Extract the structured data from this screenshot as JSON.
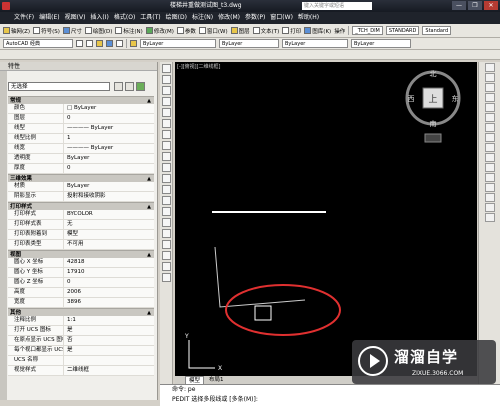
{
  "window": {
    "title": "楼梯井重做测试图_t3.dwg",
    "search_placeholder": "键入关键字或短语",
    "buttons": [
      "—",
      "❐",
      "✕"
    ]
  },
  "menubar": {
    "items": [
      "文件(F)",
      "编辑(E)",
      "视图(V)",
      "插入(I)",
      "格式(O)",
      "工具(T)",
      "绘图(D)",
      "标注(N)",
      "修改(M)",
      "参数(P)",
      "窗口(W)",
      "帮助(H)"
    ]
  },
  "toolbar1": {
    "items": [
      "轴网(Z)",
      "符号(S)",
      "尺寸",
      "绘图(D)",
      "标注(N)",
      "修改(M)",
      "参数",
      "窗口(W)",
      "图层",
      "文本(T)",
      "打印",
      "图库(K)",
      "操作"
    ],
    "dim_style": "_TCH_DIM",
    "text_style": "STANDARD",
    "standard": "Standard"
  },
  "toolbar2": {
    "workspace": "AutoCAD 经典",
    "layer_dropdown": "ByLayer",
    "color_dropdown": "ByLayer",
    "linetype_dropdown": "ByLayer",
    "plotstyle_dropdown": "ByLayer"
  },
  "properties": {
    "title": "特性",
    "selection": "无选择",
    "sections": [
      {
        "name": "常规",
        "rows": [
          {
            "k": "颜色",
            "v": "□ ByLayer"
          },
          {
            "k": "图层",
            "v": "0"
          },
          {
            "k": "线型",
            "v": "———— ByLayer"
          },
          {
            "k": "线型比例",
            "v": "1"
          },
          {
            "k": "线宽",
            "v": "———— ByLayer"
          },
          {
            "k": "透明度",
            "v": "ByLayer"
          },
          {
            "k": "厚度",
            "v": "0"
          }
        ]
      },
      {
        "name": "三维效果",
        "rows": [
          {
            "k": "材质",
            "v": "ByLayer"
          },
          {
            "k": "阴影显示",
            "v": "投射和接收阴影"
          }
        ]
      },
      {
        "name": "打印样式",
        "rows": [
          {
            "k": "打印样式",
            "v": "BYCOLOR"
          },
          {
            "k": "打印样式表",
            "v": "无"
          },
          {
            "k": "打印表附着到",
            "v": "模型"
          },
          {
            "k": "打印表类型",
            "v": "不可用"
          }
        ]
      },
      {
        "name": "视图",
        "rows": [
          {
            "k": "圆心 X 坐标",
            "v": "42818"
          },
          {
            "k": "圆心 Y 坐标",
            "v": "17910"
          },
          {
            "k": "圆心 Z 坐标",
            "v": "0"
          },
          {
            "k": "高度",
            "v": "2006"
          },
          {
            "k": "宽度",
            "v": "3896"
          }
        ]
      },
      {
        "name": "其他",
        "rows": [
          {
            "k": "注释比例",
            "v": "1:1"
          },
          {
            "k": "打开 UCS 图标",
            "v": "是"
          },
          {
            "k": "在原点显示 UCS 图标",
            "v": "否"
          },
          {
            "k": "每个视口都显示 UCS",
            "v": "是"
          },
          {
            "k": "UCS 名称",
            "v": ""
          },
          {
            "k": "视觉样式",
            "v": "二维线框"
          }
        ]
      }
    ]
  },
  "viewcube": {
    "north": "北",
    "south": "南",
    "east": "东",
    "west": "西",
    "top": "上"
  },
  "ucs": {
    "y": "Y",
    "x": "X"
  },
  "tabs": [
    "模型",
    "布局1"
  ],
  "command": {
    "line1": "命令: pe",
    "line2": "PEDIT 选择多段线或 [多条(M)]:"
  },
  "watermark": {
    "title": "溜溜自学",
    "subtitle": "ZIXUE.3066.COM"
  }
}
